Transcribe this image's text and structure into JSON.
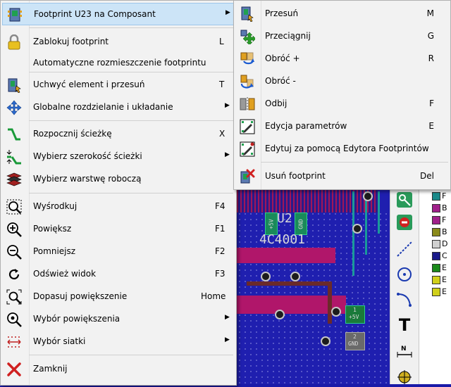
{
  "main_menu": {
    "items": [
      {
        "id": "footprint",
        "label": "Footprint U23 na Composant",
        "shortcut": "",
        "submenu": true,
        "icon": "footprint-icon"
      },
      {
        "id": "lock",
        "label": "Zablokuj footprint",
        "shortcut": "L",
        "submenu": false,
        "icon": "lock-icon"
      },
      {
        "id": "autoplace",
        "label": "Automatyczne rozmieszczenie footprintu",
        "shortcut": "",
        "submenu": false,
        "icon": ""
      },
      {
        "id": "grab",
        "label": "Uchwyć element i przesuń",
        "shortcut": "T",
        "submenu": false,
        "icon": "grab-icon"
      },
      {
        "id": "spread",
        "label": "Globalne rozdzielanie i układanie",
        "shortcut": "",
        "submenu": true,
        "icon": "move-arrows-icon"
      },
      {
        "id": "track",
        "label": "Rozpocznij ścieżkę",
        "shortcut": "X",
        "submenu": false,
        "icon": "track-icon"
      },
      {
        "id": "width",
        "label": "Wybierz szerokość ścieżki",
        "shortcut": "",
        "submenu": true,
        "icon": "track-width-icon"
      },
      {
        "id": "layer",
        "label": "Wybierz warstwę roboczą",
        "shortcut": "",
        "submenu": false,
        "icon": "layers-icon"
      },
      {
        "id": "center",
        "label": "Wyśrodkuj",
        "shortcut": "F4",
        "submenu": false,
        "icon": "zoom-center-icon"
      },
      {
        "id": "zoomin",
        "label": "Powiększ",
        "shortcut": "F1",
        "submenu": false,
        "icon": "zoom-in-icon"
      },
      {
        "id": "zoomout",
        "label": "Pomniejsz",
        "shortcut": "F2",
        "submenu": false,
        "icon": "zoom-out-icon"
      },
      {
        "id": "refresh",
        "label": "Odśwież widok",
        "shortcut": "F3",
        "submenu": false,
        "icon": "refresh-icon"
      },
      {
        "id": "fit",
        "label": "Dopasuj powiększenie",
        "shortcut": "Home",
        "submenu": false,
        "icon": "zoom-fit-icon"
      },
      {
        "id": "zoomsel",
        "label": "Wybór powiększenia",
        "shortcut": "",
        "submenu": true,
        "icon": "zoom-select-icon"
      },
      {
        "id": "grid",
        "label": "Wybór siatki",
        "shortcut": "",
        "submenu": true,
        "icon": "grid-icon"
      },
      {
        "id": "close",
        "label": "Zamknij",
        "shortcut": "",
        "submenu": false,
        "icon": "close-icon"
      }
    ]
  },
  "sub_menu": {
    "items": [
      {
        "id": "move",
        "label": "Przesuń",
        "shortcut": "M",
        "icon": "move-icon"
      },
      {
        "id": "drag",
        "label": "Przeciągnij",
        "shortcut": "G",
        "icon": "drag-icon"
      },
      {
        "id": "rotplus",
        "label": "Obróć +",
        "shortcut": "R",
        "icon": "rotate-ccw-icon"
      },
      {
        "id": "rotminus",
        "label": "Obróć -",
        "shortcut": "",
        "icon": "rotate-cw-icon"
      },
      {
        "id": "mirror",
        "label": "Odbij",
        "shortcut": "F",
        "icon": "mirror-icon"
      },
      {
        "id": "editparams",
        "label": "Edycja parametrów",
        "shortcut": "E",
        "icon": "edit-params-icon"
      },
      {
        "id": "editfp",
        "label": "Edytuj za pomocą Edytora Footprintów",
        "shortcut": "",
        "icon": "edit-footprint-icon"
      },
      {
        "id": "delete",
        "label": "Usuń footprint",
        "shortcut": "Del",
        "icon": "delete-icon"
      }
    ]
  },
  "pcb": {
    "ref": "U2",
    "value": "4C4001",
    "pad1_num": "1",
    "pad1_net": "+5V",
    "pad2_num": "2",
    "pad2_net": "GND",
    "pin_a": "+5V",
    "pin_b": "GND"
  },
  "layers_panel": {
    "items": [
      {
        "letter": "F",
        "color": "#1a8a8a"
      },
      {
        "letter": "B",
        "color": "#a0208a"
      },
      {
        "letter": "F",
        "color": "#a0208a"
      },
      {
        "letter": "B",
        "color": "#8a8a1a"
      },
      {
        "letter": "D",
        "color": "#d0d0d0"
      },
      {
        "letter": "C",
        "color": "#1a1a8a"
      },
      {
        "letter": "E",
        "color": "#1a8a1a"
      },
      {
        "letter": "E",
        "color": "#d0d01a"
      },
      {
        "letter": "E",
        "color": "#d0d01a"
      }
    ]
  }
}
